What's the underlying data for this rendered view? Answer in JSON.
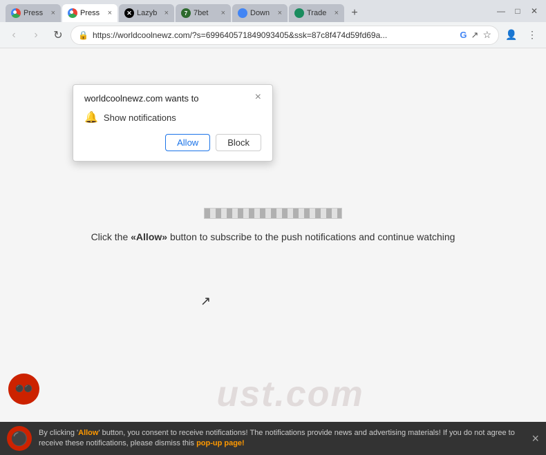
{
  "titleBar": {
    "tabs": [
      {
        "id": "tab1",
        "label": "Press",
        "active": false,
        "favicon": "chrome"
      },
      {
        "id": "tab2",
        "label": "Press",
        "active": true,
        "favicon": "chrome"
      },
      {
        "id": "tab3",
        "label": "Lazyb",
        "active": false,
        "favicon": "x"
      },
      {
        "id": "tab4",
        "label": "7bet",
        "active": false,
        "favicon": "7bet"
      },
      {
        "id": "tab5",
        "label": "Down",
        "active": false,
        "favicon": "globe"
      },
      {
        "id": "tab6",
        "label": "Trade",
        "active": false,
        "favicon": "green"
      }
    ],
    "newTabLabel": "+",
    "minimizeLabel": "—",
    "maximizeLabel": "□",
    "closeLabel": "✕"
  },
  "toolbar": {
    "backLabel": "‹",
    "forwardLabel": "›",
    "reloadLabel": "↻",
    "url": "https://worldcoolnewz.com/?s=699640571849093405&ssk=87c8f474d59fd69a...",
    "bookmarkLabel": "☆",
    "menuLabel": "⋮"
  },
  "permissionPopup": {
    "title": "worldcoolnewz.com wants to",
    "closeLabel": "×",
    "notificationText": "Show notifications",
    "allowLabel": "Allow",
    "blockLabel": "Block"
  },
  "pageContent": {
    "instructionText": "Click the «Allow» button to subscribe to the push notifications and continue watching",
    "allowBoldText": "«Allow»"
  },
  "watermark": {
    "text": "ust.com"
  },
  "notificationBar": {
    "mainText": "By clicking 'Allow' button, you consent to receive notifications! The notifications provide news and advertising materials! If you do not agree to receive these notifications, please dismiss this pop-up page!",
    "closeLabel": "×"
  }
}
